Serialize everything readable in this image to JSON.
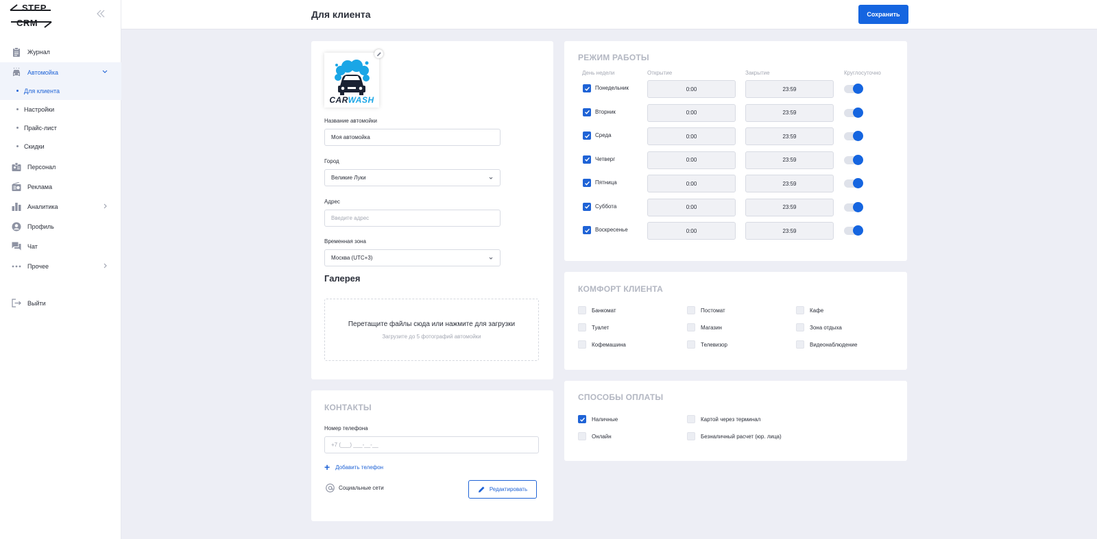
{
  "brand": {
    "line1": "STEP",
    "line2": "CRM"
  },
  "sidebar": {
    "items": [
      {
        "label": "Журнал",
        "icon": "clipboard-icon"
      },
      {
        "label": "Автомойка",
        "icon": "car-icon"
      },
      {
        "label": "Персонал",
        "icon": "badge-icon"
      },
      {
        "label": "Реклама",
        "icon": "radio-icon"
      },
      {
        "label": "Аналитика",
        "icon": "bar-chart-icon"
      },
      {
        "label": "Профиль",
        "icon": "user-circle-icon"
      },
      {
        "label": "Чат",
        "icon": "chat-icon"
      },
      {
        "label": "Прочее",
        "icon": "dots-icon"
      },
      {
        "label": "Выйти",
        "icon": "logout-icon"
      }
    ],
    "subitems": [
      {
        "label": "Для клиента"
      },
      {
        "label": "Настройки"
      },
      {
        "label": "Прайс-лист"
      },
      {
        "label": "Скидки"
      }
    ]
  },
  "header": {
    "title": "Для клиента",
    "save_label": "Сохранить"
  },
  "profile": {
    "logo_text_a": "CAR",
    "logo_text_b": "WASH",
    "name_label": "Название автомойки",
    "name_value": "Моя автомойка",
    "city_label": "Город",
    "city_value": "Великие Луки",
    "address_label": "Адрес",
    "address_placeholder": "Введите адрес",
    "tz_label": "Временная зона",
    "tz_value": "Москва (UTC+3)",
    "gallery_title": "Галерея",
    "dropzone_main": "Перетащите файлы сюда или нажмите для загрузки",
    "dropzone_sub": "Загрузите до 5 фотографий автомойки"
  },
  "contacts": {
    "title": "КОНТАКТЫ",
    "phone_label": "Номер телефона",
    "phone_placeholder": "+7 (___) ___-__-__",
    "add_phone_label": "Добавить телефон",
    "social_label": "Социальные сети",
    "edit_label": "Редактировать"
  },
  "schedule": {
    "title": "РЕЖИМ РАБОТЫ",
    "headers": {
      "day": "День недели",
      "open": "Открытие",
      "close": "Закрытие",
      "allday": "Круглосуточно"
    },
    "days": [
      {
        "name": "Понедельник",
        "open": "0:00",
        "close": "23:59",
        "enabled": true,
        "allday": true
      },
      {
        "name": "Вторник",
        "open": "0:00",
        "close": "23:59",
        "enabled": true,
        "allday": true
      },
      {
        "name": "Среда",
        "open": "0:00",
        "close": "23:59",
        "enabled": true,
        "allday": true
      },
      {
        "name": "Четверг",
        "open": "0:00",
        "close": "23:59",
        "enabled": true,
        "allday": true
      },
      {
        "name": "Пятница",
        "open": "0:00",
        "close": "23:59",
        "enabled": true,
        "allday": true
      },
      {
        "name": "Суббота",
        "open": "0:00",
        "close": "23:59",
        "enabled": true,
        "allday": true
      },
      {
        "name": "Воскресенье",
        "open": "0:00",
        "close": "23:59",
        "enabled": true,
        "allday": true
      }
    ]
  },
  "comfort": {
    "title": "КОМФОРТ КЛИЕНТА",
    "options": [
      {
        "label": "Банкомат",
        "checked": false
      },
      {
        "label": "Постомат",
        "checked": false
      },
      {
        "label": "Кафе",
        "checked": false
      },
      {
        "label": "Туалет",
        "checked": false
      },
      {
        "label": "Магазин",
        "checked": false
      },
      {
        "label": "Зона отдыха",
        "checked": false
      },
      {
        "label": "Кофемашина",
        "checked": false
      },
      {
        "label": "Телевизор",
        "checked": false
      },
      {
        "label": "Видеонаблюдение",
        "checked": false
      }
    ]
  },
  "payment": {
    "title": "СПОСОБЫ ОПЛАТЫ",
    "options": [
      {
        "label": "Наличные",
        "checked": true
      },
      {
        "label": "Картой через терминал",
        "checked": false
      },
      {
        "label": "Онлайн",
        "checked": false
      },
      {
        "label": "Безналичный расчет (юр. лица)",
        "checked": false
      }
    ]
  },
  "colors": {
    "accent": "#1565e0",
    "muted": "#b3b7c2",
    "background": "#edeef5"
  }
}
